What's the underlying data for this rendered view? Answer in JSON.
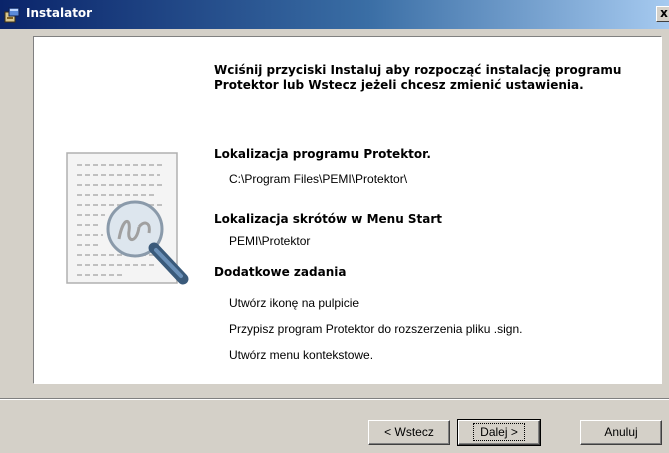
{
  "window": {
    "title": "Instalator",
    "close_label": "x"
  },
  "intro": "Wciśnij przyciski Instaluj aby rozpocząć instalację programu Protektor lub Wstecz jeżeli chcesz zmienić ustawienia.",
  "sections": {
    "location": {
      "heading": "Lokalizacja programu Protektor.",
      "value": "C:\\Program Files\\PEMI\\Protektor\\"
    },
    "shortcuts": {
      "heading": "Lokalizacja skrótów w Menu Start",
      "value": "PEMI\\Protektor"
    },
    "tasks": {
      "heading": "Dodatkowe zadania",
      "items": [
        "Utwórz ikonę na pulpicie",
        "Przypisz program Protektor do rozszerzenia pliku .sign.",
        "Utwórz menu kontekstowe."
      ]
    }
  },
  "buttons": {
    "back": "< Wstecz",
    "next": "Dalej >",
    "cancel": "Anuluj"
  },
  "icons": {
    "window_icon": "installer-icon",
    "illustration": "document-magnifier-icon"
  },
  "colors": {
    "titlebar_start": "#0a246a",
    "titlebar_end": "#a6caf0",
    "dialog_bg": "#d4d0c8"
  }
}
